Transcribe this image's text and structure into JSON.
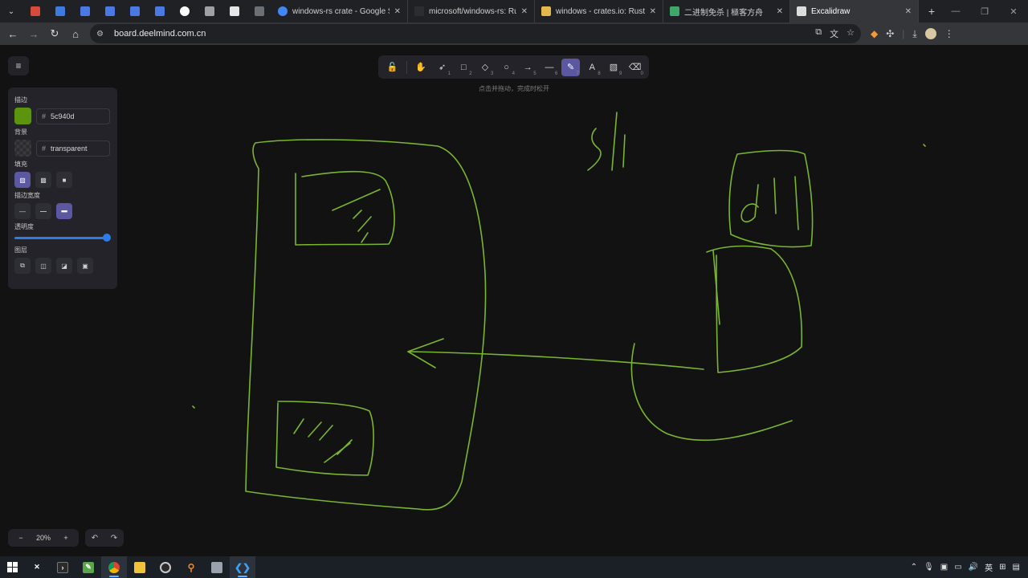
{
  "browser": {
    "tabs": [
      {
        "title": "windows-rs crate - Google S",
        "icon": "google-icon",
        "color": "#4285f4"
      },
      {
        "title": "microsoft/windows-rs: Rust f",
        "icon": "github-icon",
        "color": "#ffffff"
      },
      {
        "title": "windows - crates.io: Rust Pac",
        "icon": "crates-icon",
        "color": "#e5b84b"
      },
      {
        "title": "二进制免杀 | 極客方舟",
        "icon": "site-icon",
        "color": "#3ea86b"
      },
      {
        "title": "Excalidraw",
        "icon": "excalidraw-icon",
        "color": "#dddddd",
        "active": true
      }
    ],
    "url": "board.deelmind.com.cn"
  },
  "toolbar": {
    "tools": [
      {
        "name": "lock-tool",
        "glyph": "🔓",
        "key": ""
      },
      {
        "name": "hand-tool",
        "glyph": "✋",
        "key": ""
      },
      {
        "name": "selection-tool",
        "glyph": "➶",
        "key": "1"
      },
      {
        "name": "rectangle-tool",
        "glyph": "□",
        "key": "2"
      },
      {
        "name": "diamond-tool",
        "glyph": "◇",
        "key": "3"
      },
      {
        "name": "ellipse-tool",
        "glyph": "○",
        "key": "4"
      },
      {
        "name": "arrow-tool",
        "glyph": "→",
        "key": "5"
      },
      {
        "name": "line-tool",
        "glyph": "—",
        "key": "6"
      },
      {
        "name": "draw-tool",
        "glyph": "✎",
        "key": "7",
        "active": true
      },
      {
        "name": "text-tool",
        "glyph": "A",
        "key": "8"
      },
      {
        "name": "image-tool",
        "glyph": "▧",
        "key": "9"
      },
      {
        "name": "eraser-tool",
        "glyph": "⌫",
        "key": "0"
      }
    ],
    "hint": "点击并拖动，完成时松开"
  },
  "properties": {
    "stroke_label": "描边",
    "stroke_color": "5c940d",
    "stroke_swatch": "#5c940d",
    "background_label": "背景",
    "background_value": "transparent",
    "fill_label": "填充",
    "stroke_width_label": "描边宽度",
    "opacity_label": "透明度",
    "opacity_value": 1.0,
    "layers_label": "图层"
  },
  "zoom": {
    "level": "20%",
    "minus": "−",
    "plus": "+"
  },
  "canvas_text": {
    "top_word": "S//",
    "box_word": "dll"
  },
  "taskbar": {
    "lang": "英"
  },
  "colors": {
    "drawing": "#7ab52f",
    "accent": "#5b57a0",
    "slider": "#2b7de9"
  }
}
